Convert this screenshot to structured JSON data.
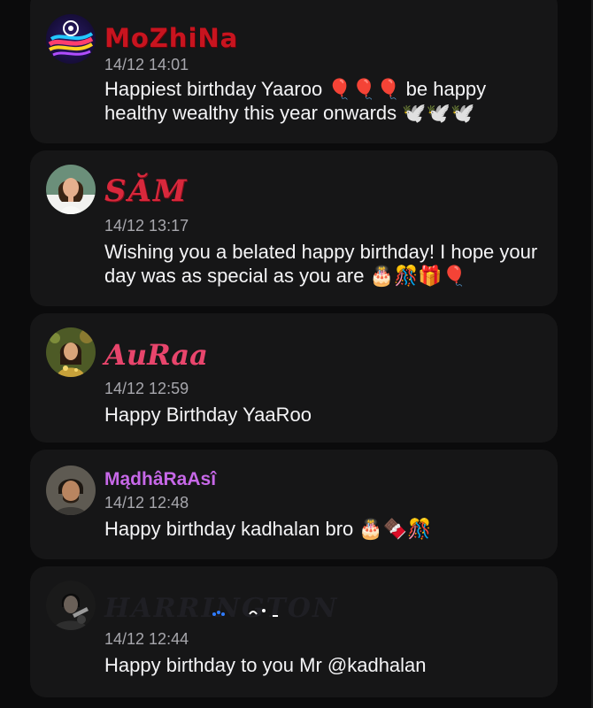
{
  "comments": [
    {
      "name": "MoZhiNa",
      "time": "14/12 14:01",
      "text": "Happiest birthday Yaaroo 🎈🎈🎈 be happy healthy wealthy this year onwards 🕊️🕊️🕊️",
      "avatar": "colorful-logo-avatar"
    },
    {
      "name": "SĂM",
      "time": "14/12 13:17",
      "text": "Wishing you a belated happy birthday! I hope your day was as special as you are 🎂🎊🎁🎈",
      "avatar": "woman-portrait-avatar"
    },
    {
      "name": "AuRaa",
      "time": "14/12 12:59",
      "text": "Happy Birthday YaaRoo",
      "avatar": "girl-green-avatar"
    },
    {
      "name": "MądhâRaAsî",
      "time": "14/12 12:48",
      "text": "Happy birthday kadhalan bro 🎂🍫🎊",
      "avatar": "man-portrait-avatar"
    },
    {
      "name": "HARRINGTON",
      "time": "14/12 12:44",
      "text": "Happy birthday to you Mr @kadhalan",
      "avatar": "dark-photo-avatar"
    }
  ],
  "colors": {
    "background": "#0b0b0c",
    "card": "#161617",
    "text": "#f4f4f6",
    "timestamp": "#a7a7ad"
  }
}
